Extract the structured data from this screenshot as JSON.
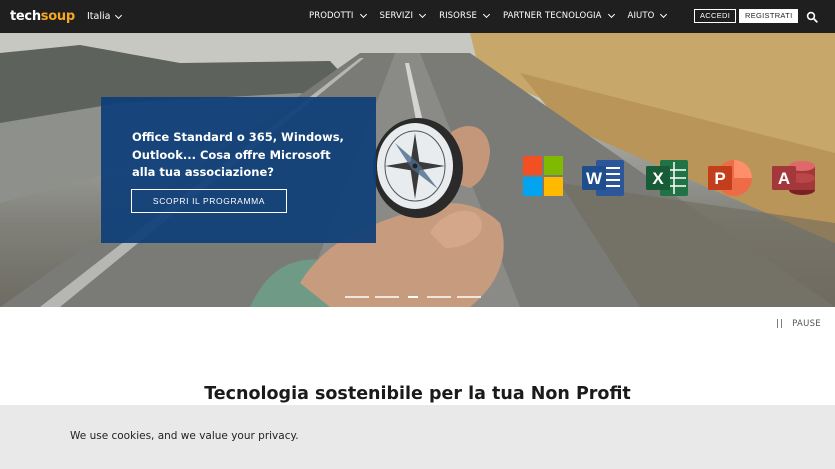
{
  "nav": {
    "logo_part1": "tech",
    "logo_part2": "soup",
    "region": "Italia",
    "items": [
      "PRODOTTI",
      "SERVIZI",
      "RISORSE",
      "PARTNER TECNOLOGIA",
      "AIUTO"
    ],
    "login": "ACCEDI",
    "register": "REGISTRATI"
  },
  "hero": {
    "promo_text": "Office Standard o 365, Windows, Outlook... Cosa offre Microsoft alla tua associazione?",
    "cta": "SCOPRI IL PROGRAMMA",
    "apps": [
      "W",
      "X",
      "P",
      "A"
    ],
    "slides_count": 5,
    "active_slide": 3
  },
  "carousel": {
    "pause_icon": "||",
    "pause_label": "PAUSE"
  },
  "section": {
    "headline": "Tecnologia sostenibile per la tua Non Profit"
  },
  "cookie": {
    "text": "We use cookies, and we value your privacy."
  },
  "colors": {
    "topbar": "#1f1f1f",
    "accent": "#f5a623",
    "promo_bg": "#0e3e78",
    "word": "#2b579a",
    "excel": "#217346",
    "powerpoint": "#d24726",
    "access": "#a4373a"
  }
}
